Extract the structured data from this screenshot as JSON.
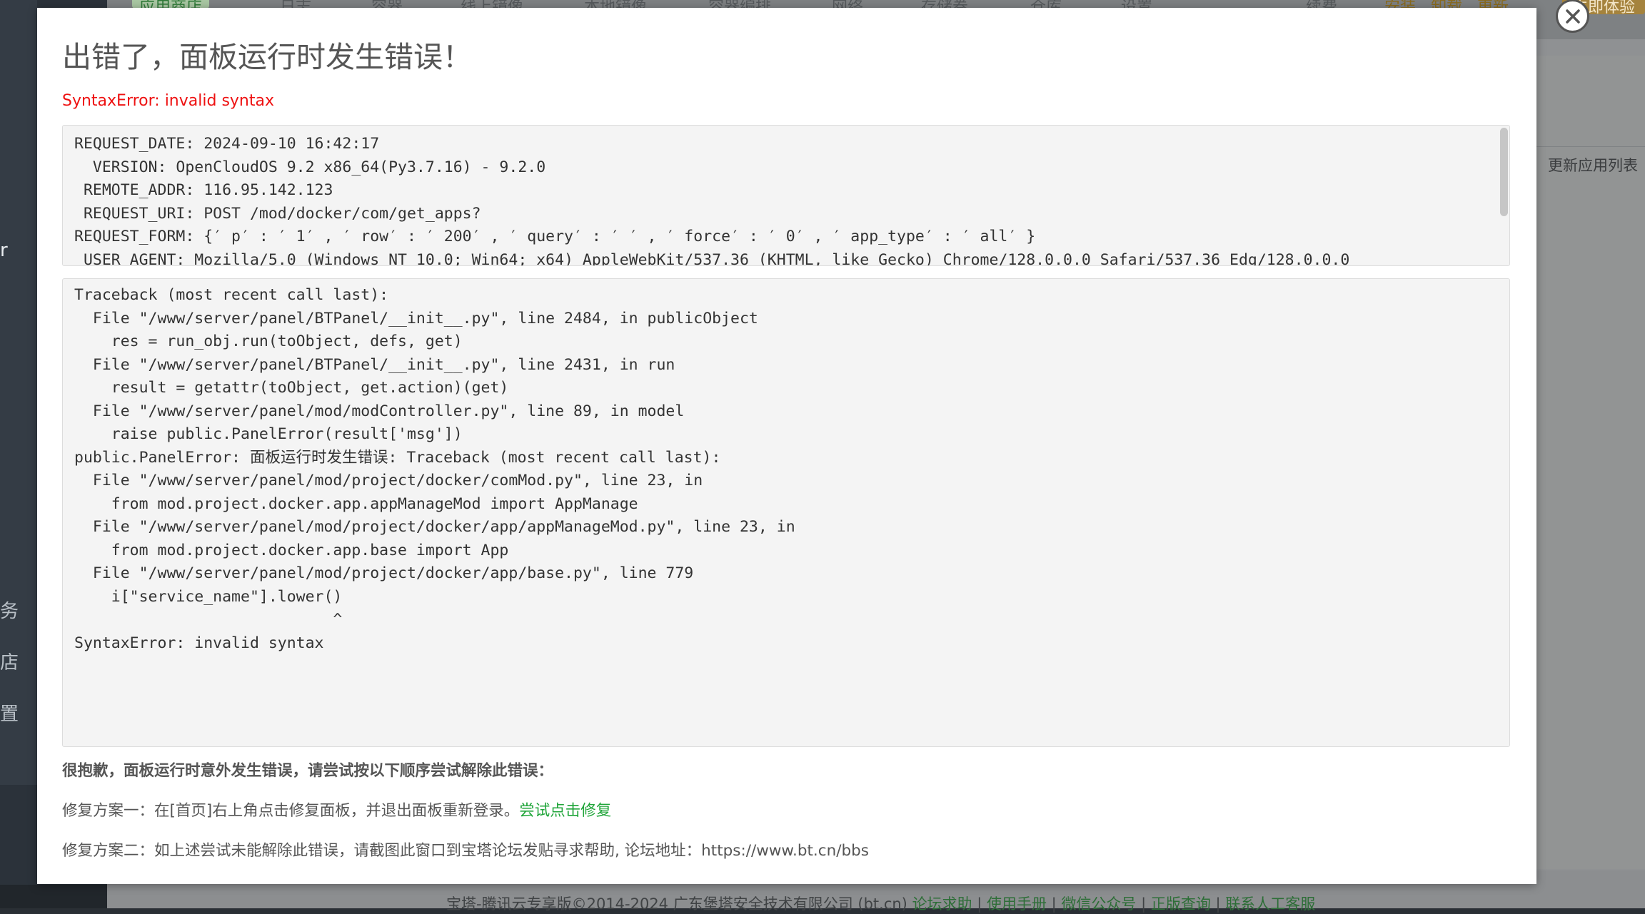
{
  "background": {
    "sidebar_items": [
      "r",
      "务",
      "店",
      "置"
    ],
    "top_tabs": [
      "应用商店",
      "日志",
      "容器",
      "线上镜像",
      "本地镜像",
      "容器编排",
      "网络",
      "存储卷",
      "仓库",
      "设置"
    ],
    "top_right": {
      "renew": "续费",
      "links": [
        "安装",
        "卸载",
        "更新"
      ],
      "cta": "立即体验"
    },
    "right_panel_button": "更新应用列表",
    "footer": {
      "copyright": "宝塔-腾讯云专享版©2014-2024 广东堡塔安全技术有限公司 (bt.cn)",
      "links": [
        "论坛求助",
        "使用手册",
        "微信公众号",
        "正版查询",
        "联系人工客服"
      ]
    }
  },
  "modal": {
    "title": "出错了，面板运行时发生错误！",
    "error_summary": "SyntaxError: invalid syntax",
    "request_info": [
      "REQUEST_DATE: 2024-09-10 16:42:17",
      "  VERSION: OpenCloudOS 9.2 x86_64(Py3.7.16) - 9.2.0",
      " REMOTE_ADDR: 116.95.142.123",
      " REQUEST_URI: POST /mod/docker/com/get_apps?",
      "REQUEST_FORM: {′ p′ : ′ 1′ , ′ row′ : ′ 200′ , ′ query′ : ′ ′ , ′ force′ : ′ 0′ , ′ app_type′ : ′ all′ }",
      " USER_AGENT: Mozilla/5.0 (Windows NT 10.0; Win64; x64) AppleWebKit/537.36 (KHTML, like Gecko) Chrome/128.0.0.0 Safari/537.36 Edg/128.0.0.0"
    ],
    "traceback": [
      "Traceback (most recent call last):",
      "  File \"/www/server/panel/BTPanel/__init__.py\", line 2484, in publicObject",
      "    res = run_obj.run(toObject, defs, get)",
      "  File \"/www/server/panel/BTPanel/__init__.py\", line 2431, in run",
      "    result = getattr(toObject, get.action)(get)",
      "  File \"/www/server/panel/mod/modController.py\", line 89, in model",
      "    raise public.PanelError(result['msg'])",
      "public.PanelError: 面板运行时发生错误: Traceback (most recent call last):",
      "  File \"/www/server/panel/mod/project/docker/comMod.py\", line 23, in",
      "    from mod.project.docker.app.appManageMod import AppManage",
      "  File \"/www/server/panel/mod/project/docker/app/appManageMod.py\", line 23, in",
      "    from mod.project.docker.app.base import App",
      "  File \"/www/server/panel/mod/project/docker/app/base.py\", line 779",
      "    i[\"service_name\"].lower()",
      "                            ^",
      "SyntaxError: invalid syntax"
    ],
    "help_heading": "很抱歉，面板运行时意外发生错误，请尝试按以下顺序尝试解除此错误：",
    "fix_1_text": "修复方案一：在[首页]右上角点击修复面板，并退出面板重新登录。",
    "fix_1_link": "尝试点击修复",
    "fix_2_text": "修复方案二：如上述尝试未能解除此错误，请截图此窗口到宝塔论坛发贴寻求帮助, 论坛地址：https://www.bt.cn/bbs",
    "close_icon": "close-icon"
  },
  "colors": {
    "error_red": "#ee1111",
    "link_green": "#20a53a",
    "text_gray": "#555555",
    "code_bg": "#f4f4f4"
  }
}
